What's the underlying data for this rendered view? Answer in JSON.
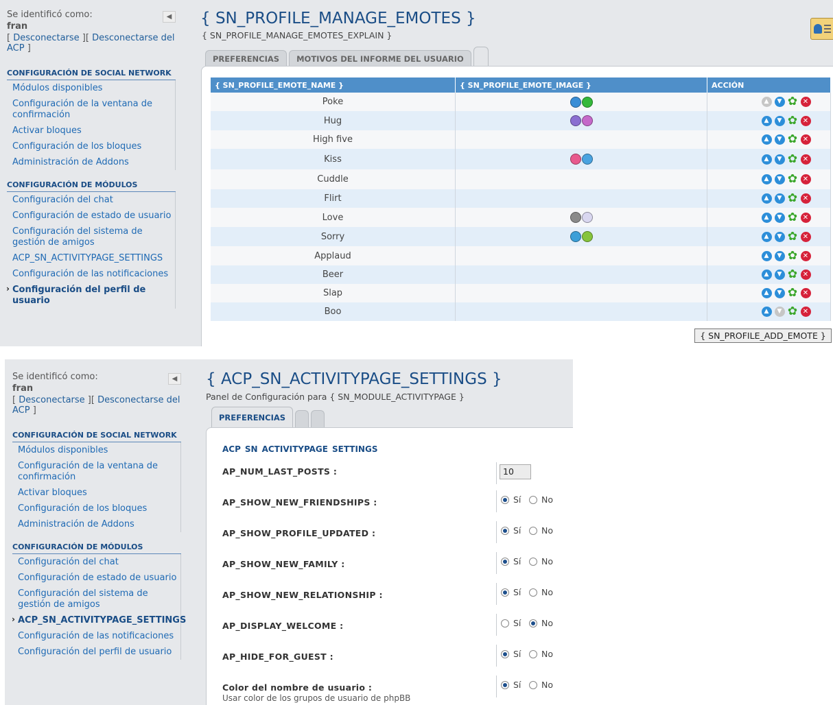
{
  "panel1": {
    "user": {
      "label": "Se identificó como:",
      "name": "fran",
      "link_open": "[ ",
      "logout": "Desconectarse",
      "link_mid": " ][ ",
      "logout_acp": "Desconectarse del ACP",
      "link_close": " ]"
    },
    "collapse_icon": "triangle-left",
    "menu1": {
      "heading": "CONFIGURACIÓN DE SOCIAL NETWORK",
      "items": [
        "Módulos disponibles",
        "Configuración de la ventana de confirmación",
        "Activar bloques",
        "Configuración de los bloques",
        "Administración de Addons"
      ]
    },
    "menu2": {
      "heading": "CONFIGURACIÓN DE MÓDULOS",
      "items": [
        "Configuración del chat",
        "Configuración de estado de usuario",
        "Configuración del sistema de gestión de amigos",
        "ACP_SN_ACTIVITYPAGE_SETTINGS",
        "Configuración de las notificaciones",
        "Configuración del perfil de usuario"
      ],
      "active_index": 5
    },
    "title": "{ SN_PROFILE_MANAGE_EMOTES }",
    "subtitle": "{ SN_PROFILE_MANAGE_EMOTES_EXPLAIN }",
    "tabs": [
      "PREFERENCIAS",
      "MOTIVOS DEL INFORME DEL USUARIO"
    ],
    "table": {
      "headers": [
        "{ SN_PROFILE_EMOTE_NAME }",
        "{ SN_PROFILE_EMOTE_IMAGE }",
        "ACCIÓN"
      ],
      "rows": [
        {
          "name": "Poke",
          "image": [
            "#3a8ed6",
            "#35b83b"
          ],
          "up": false,
          "down": true
        },
        {
          "name": "Hug",
          "image": [
            "#8a6fd1",
            "#c569c9"
          ],
          "up": true,
          "down": true
        },
        {
          "name": "High five",
          "image": [],
          "up": true,
          "down": true
        },
        {
          "name": "Kiss",
          "image": [
            "#e85a8e",
            "#4aa3e0"
          ],
          "up": true,
          "down": true
        },
        {
          "name": "Cuddle",
          "image": [],
          "up": true,
          "down": true
        },
        {
          "name": "Flirt",
          "image": [],
          "up": true,
          "down": true
        },
        {
          "name": "Love",
          "image": [
            "#8a8a8a",
            "#d9d7f0"
          ],
          "up": true,
          "down": true
        },
        {
          "name": "Sorry",
          "image": [
            "#3b9fd8",
            "#86c43c"
          ],
          "up": true,
          "down": true
        },
        {
          "name": "Applaud",
          "image": [],
          "up": true,
          "down": true
        },
        {
          "name": "Beer",
          "image": [],
          "up": true,
          "down": true
        },
        {
          "name": "Slap",
          "image": [],
          "up": true,
          "down": true
        },
        {
          "name": "Boo",
          "image": [],
          "up": true,
          "down": false
        }
      ]
    },
    "add_button": "{ SN_PROFILE_ADD_EMOTE }"
  },
  "panel2": {
    "title": "{ ACP_SN_ACTIVITYPAGE_SETTINGS }",
    "subtitle": "Panel de Configuración para { SN_MODULE_ACTIVITYPAGE }",
    "tabs": [
      "PREFERENCIAS"
    ],
    "menu2_active_index": 3,
    "fieldset_title": "ACP_SN_ACTIVITYPAGE_SETTINGS",
    "settings": [
      {
        "label": "AP_NUM_LAST_POSTS :",
        "type": "text",
        "value": "10"
      },
      {
        "label": "AP_SHOW_NEW_FRIENDSHIPS :",
        "type": "radio",
        "value": "yes"
      },
      {
        "label": "AP_SHOW_PROFILE_UPDATED :",
        "type": "radio",
        "value": "yes"
      },
      {
        "label": "AP_SHOW_NEW_FAMILY :",
        "type": "radio",
        "value": "yes"
      },
      {
        "label": "AP_SHOW_NEW_RELATIONSHIP :",
        "type": "radio",
        "value": "yes"
      },
      {
        "label": "AP_DISPLAY_WELCOME :",
        "type": "radio",
        "value": "no"
      },
      {
        "label": "AP_HIDE_FOR_GUEST :",
        "type": "radio",
        "value": "yes"
      },
      {
        "label": "Color del nombre de usuario :",
        "sublabel": "Usar color de los grupos de usuario de phpBB",
        "type": "radio",
        "value": "yes"
      }
    ],
    "radio_yes": "Sí",
    "radio_no": "No"
  }
}
